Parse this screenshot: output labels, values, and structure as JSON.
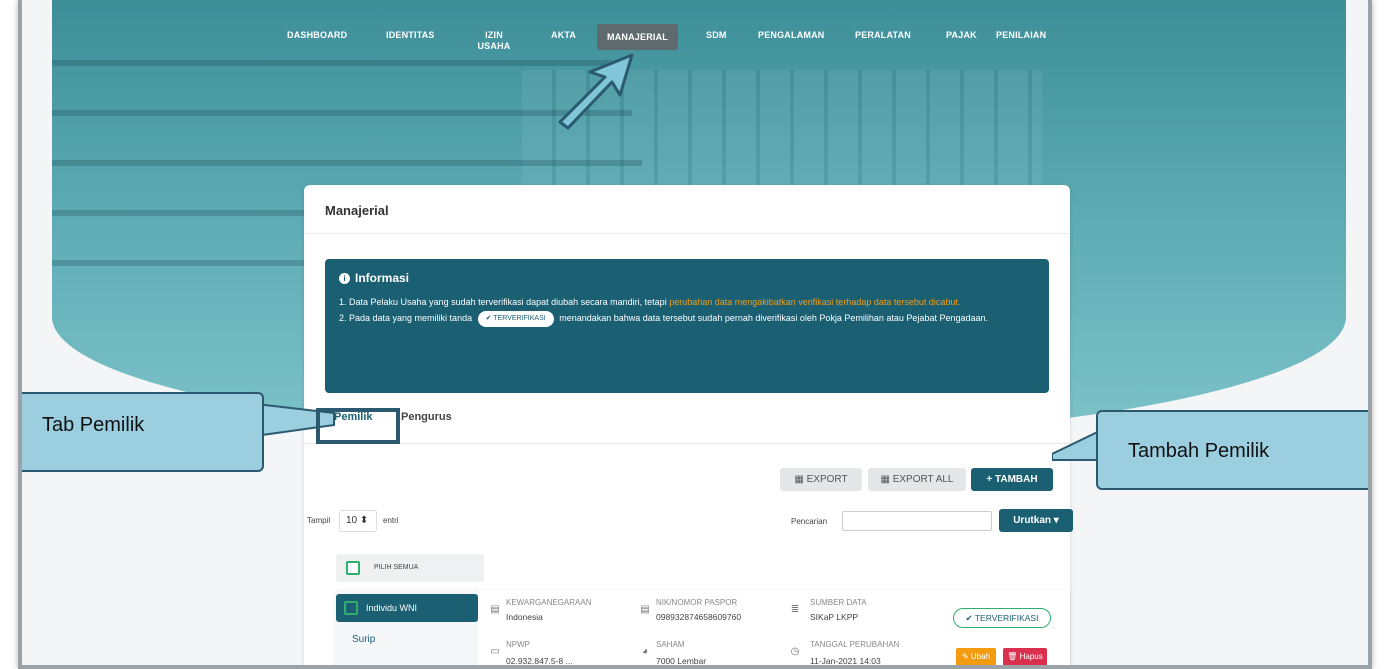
{
  "nav": {
    "items": [
      "DASHBOARD",
      "IDENTITAS",
      "IZIN\nUSAHA",
      "AKTA",
      "MANAJERIAL",
      "SDM",
      "PENGALAMAN",
      "PERALATAN",
      "PAJAK",
      "PENILAIAN"
    ],
    "active": "MANAJERIAL"
  },
  "card": {
    "title": "Manajerial"
  },
  "info": {
    "title": "Informasi",
    "line1_a": "1. Data Pelaku Usaha yang sudah terverifikasi dapat diubah secara mandiri, tetapi ",
    "line1_b": "perubahan data mengakibatkan verifikasi terhadap data tersebut dicabut.",
    "line2_a": "2. Pada data yang memiliki tanda",
    "badge": "✔ TERVERIFIKASI",
    "line2_b": "menandakan bahwa data tersebut sudah pernah diverifikasi oleh Pokja Pemilihan atau Pejabat Pengadaan."
  },
  "tabs": {
    "pemilik": "Pemilik",
    "pengurus": "Pengurus"
  },
  "toolbar": {
    "export": "EXPORT",
    "export_all": "EXPORT ALL",
    "tambah": "+ TAMBAH"
  },
  "list_controls": {
    "tampil": "Tampil",
    "entries": "10 ⬍",
    "entri": "entri",
    "pencarian": "Pencarian",
    "urutkan": "Urutkan ▾",
    "pilih_semua": "PILIH SEMUA"
  },
  "row": {
    "jenis": "Individu WNI",
    "nama": "Surip",
    "kewarganegaraan_label": "KEWARGANEGARAAN",
    "kewarganegaraan": "Indonesia",
    "npwp_label": "NPWP",
    "npwp": "02.932.847.5-8 ...",
    "nik_label": "NIK/NOMOR PASPOR",
    "nik": "098932874658609760",
    "saham_label": "SAHAM",
    "saham": "7000 Lembar",
    "sumber_label": "SUMBER DATA",
    "sumber": "SIKaP LKPP",
    "tanggal_label": "TANGGAL PERUBAHAN",
    "tanggal": "11-Jan-2021 14:03",
    "status": "✔ TERVERIFIKASI",
    "ubah": "✎ Ubah",
    "hapus": "🗑 Hapus"
  },
  "callouts": {
    "tab": "Tab Pemilik",
    "tambah": "Tambah Pemilik"
  },
  "colors": {
    "primary": "#1b5f73",
    "accent_orange": "#f39c12",
    "danger": "#d9304e",
    "callout": "#9bcfdf"
  }
}
